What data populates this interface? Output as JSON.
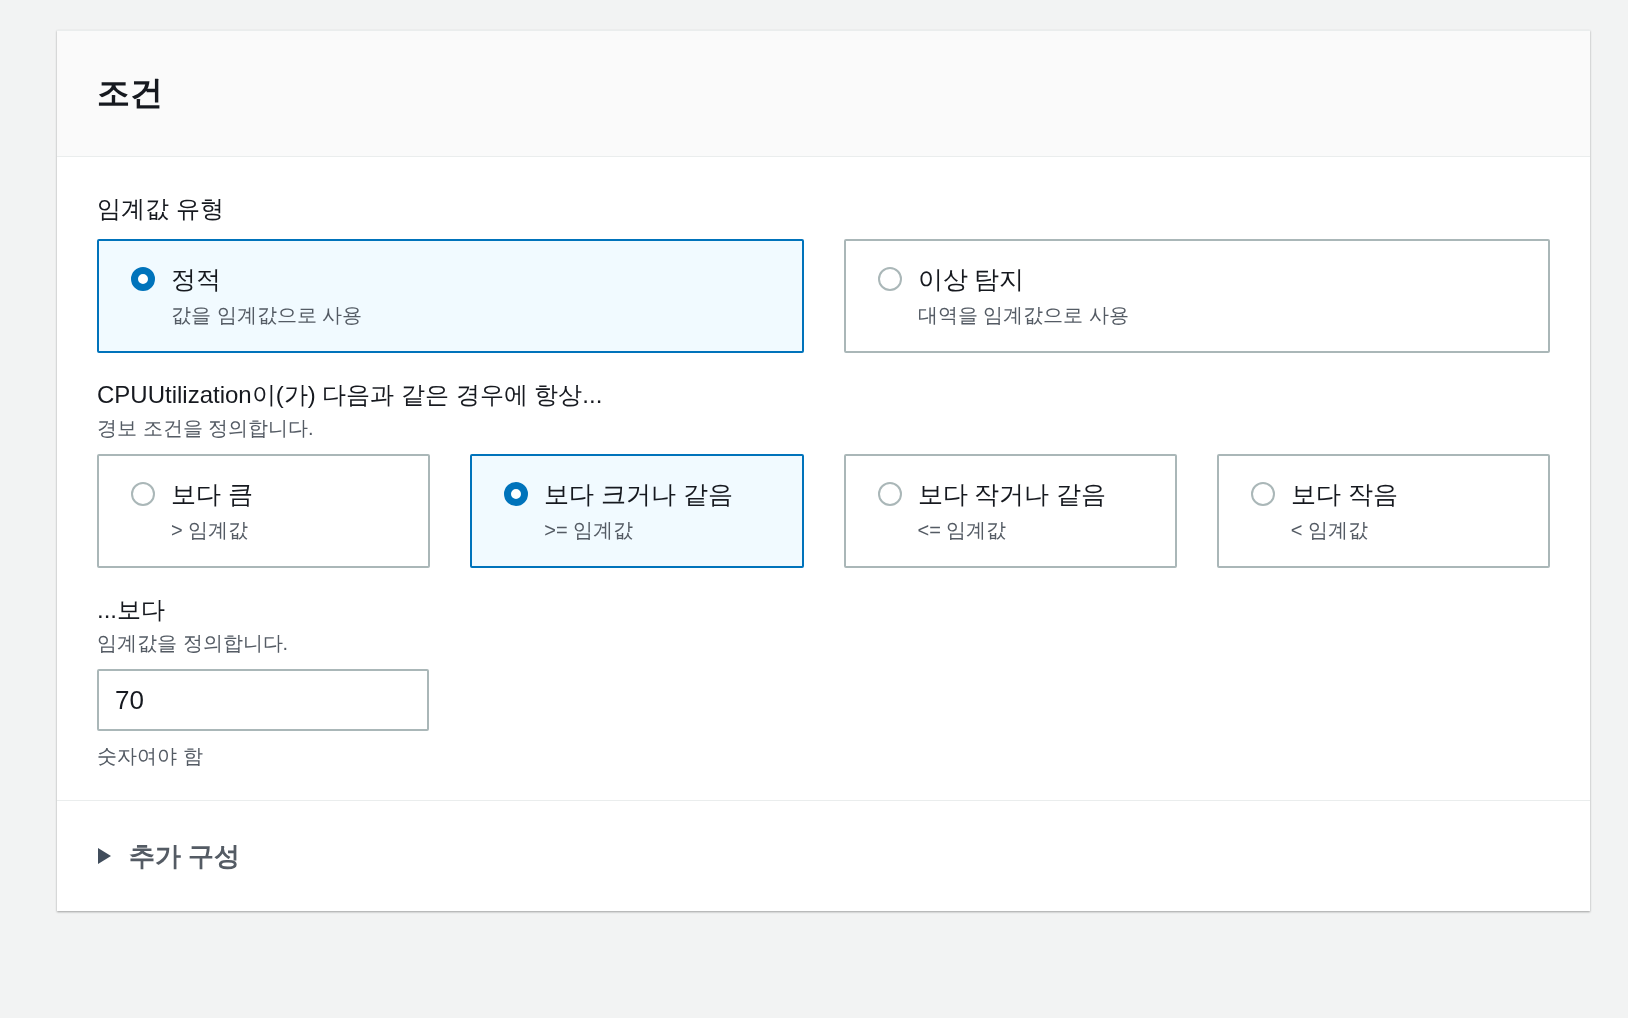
{
  "section": {
    "title": "조건"
  },
  "threshold_type": {
    "label": "임계값 유형",
    "options": [
      {
        "label": "정적",
        "description": "값을 임계값으로 사용",
        "selected": true
      },
      {
        "label": "이상 탐지",
        "description": "대역을 임계값으로 사용",
        "selected": false
      }
    ]
  },
  "condition": {
    "label": "CPUUtilization이(가) 다음과 같은 경우에 항상...",
    "description": "경보 조건을 정의합니다.",
    "options": [
      {
        "label": "보다 큼",
        "description": "> 임계값",
        "selected": false
      },
      {
        "label": "보다 크거나 같음",
        "description": ">= 임계값",
        "selected": true
      },
      {
        "label": "보다 작거나 같음",
        "description": "<= 임계값",
        "selected": false
      },
      {
        "label": "보다 작음",
        "description": "< 임계값",
        "selected": false
      }
    ]
  },
  "threshold": {
    "label": "...보다",
    "description": "임계값을 정의합니다.",
    "value": "70",
    "hint": "숫자여야 함"
  },
  "additional": {
    "label": "추가 구성",
    "expanded": false
  }
}
